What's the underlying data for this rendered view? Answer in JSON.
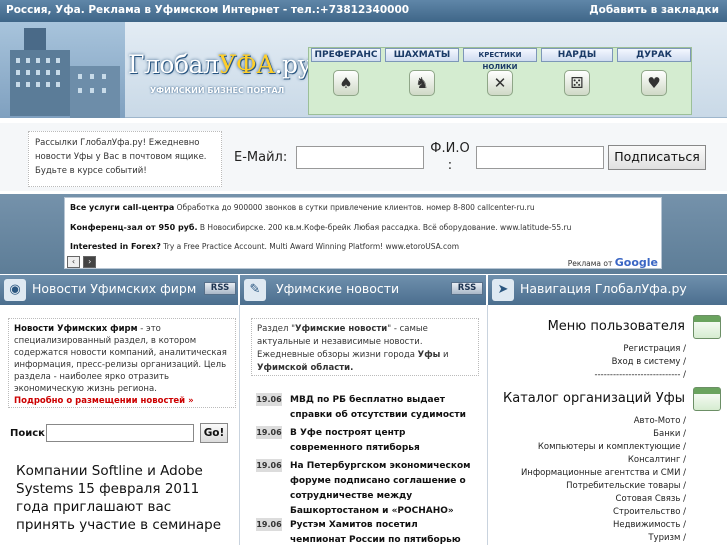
{
  "topbar": {
    "left_text": "Россия, Уфа. Реклама в Уфимском Интернет - тел.:+73812340000",
    "bookmark_link": "Добавить в закладки"
  },
  "header": {
    "logo_main": "Глобал",
    "logo_accent": "УФА",
    "logo_suffix": ".ру",
    "slogan": "УФИМСКИЙ БИЗНЕС ПОРТАЛ",
    "games": [
      {
        "label": "ПРЕФЕРАНС",
        "icon": "cards-icon"
      },
      {
        "label": "ШАХМАТЫ",
        "icon": "chess-icon"
      },
      {
        "label": "КРЕСТИКИ НОЛИКИ",
        "icon": "tictactoe-icon"
      },
      {
        "label": "НАРДЫ",
        "icon": "dice-icon"
      },
      {
        "label": "ДУРАК",
        "icon": "cards-icon"
      }
    ]
  },
  "subscribe": {
    "description": "Рассылки ГлобалУфа.ру! Ежедневно новости Уфы у Вас в почтовом ящике. Будьте в курсе событий!",
    "email_label": "E-Майл:",
    "email_value": "",
    "fio_label": "Ф.И.О :",
    "fio_value": "",
    "button": "Подписаться"
  },
  "ads": {
    "items": [
      {
        "title": "Все услуги call-центра",
        "text": "Обработка до 900000 звонков в сутки привлечение клиентов. номер 8-800 callcenter-ru.ru"
      },
      {
        "title": "Конференц-зал от 950 руб.",
        "text": "В Новосибирске. 200 кв.м.Кофе-брейк Любая рассадка. Всё оборудование. www.latitude-55.ru"
      },
      {
        "title": "Interested in Forex?",
        "text": "Try a Free Practice Account. Multi Award Winning Platform! www.etoroUSA.com"
      }
    ],
    "prev": "‹",
    "next": "›",
    "google_label": "Реклама от",
    "google_brand": "Google"
  },
  "sections": {
    "firms": {
      "title": "Новости Уфимских фирм",
      "rss": "RSS",
      "icon": "globe-icon"
    },
    "news": {
      "title": "Уфимские новости",
      "rss": "RSS",
      "icon": "newspaper-icon"
    },
    "nav": {
      "title": "Навигация ГлобалУфа.ру",
      "icon": "navigation-icon"
    }
  },
  "firms_column": {
    "info_title": "Новости Уфимских фирм",
    "info_text": " - это специализированный раздел, в котором содержатся новости компаний, аналитическая информация, пресс-релизы организаций. Цель раздела - наиболее ярко отразить экономическую жизнь региона.",
    "info_more": "Подробно о размещении новостей »",
    "search_label": "Поиск:",
    "search_value": "",
    "search_button": "Go!",
    "promo": "Компании Softline и Adobe Systems 15 февраля 2011 года приглашают вас принять участие в семинаре"
  },
  "news_column": {
    "info_pre": "Раздел \"",
    "info_title": "Уфимские новости",
    "info_mid": "\" - самые актуальные и независимые новости. Ежедневные обзоры жизни города ",
    "info_city": "Уфы",
    "info_and": " и ",
    "info_region": "Уфимской области.",
    "items": [
      {
        "date": "19.06",
        "headline": "МВД по РБ бесплатно выдает справки об отсутствии судимости"
      },
      {
        "date": "19.06",
        "headline": "В Уфе построят центр современного пятиборья"
      },
      {
        "date": "19.06",
        "headline": "На Петербургском экономическом форуме подписано соглашение о сотрудничестве между Башкортостаном и «РОСНАНО»"
      },
      {
        "date": "19.06",
        "headline": "Рустэм Хамитов посетил чемпионат России по пятиборью"
      }
    ]
  },
  "nav_column": {
    "user_menu_title": "Меню пользователя",
    "user_links": [
      "Регистрация /",
      "Вход в систему /",
      "---------------------------- /"
    ],
    "catalog_title": "Каталог организаций Уфы",
    "catalog_links": [
      "Авто-Мото /",
      "Банки /",
      "Компьютеры и комплектующие /",
      "Консалтинг /",
      "Информационные агентства и СМИ /",
      "Потребительские товары /",
      "Сотовая Связь /",
      "Строительство /",
      "Недвижимость /",
      "Туризм /"
    ]
  }
}
